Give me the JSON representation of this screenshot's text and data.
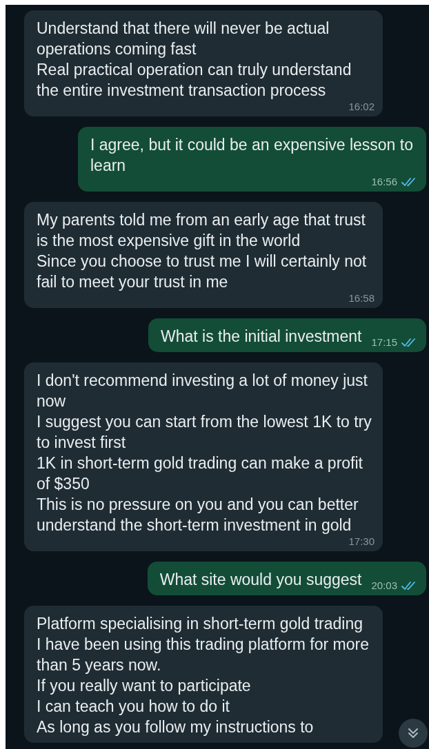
{
  "messages": [
    {
      "kind": "received",
      "paragraphs": [
        "Understand that there will never be actual operations coming fast",
        "Real practical operation can truly understand the entire investment transaction process"
      ],
      "time": "16:02"
    },
    {
      "kind": "sent",
      "paragraphs": [
        "I agree, but it could be an expensive lesson to learn"
      ],
      "time": "16:56",
      "read": true
    },
    {
      "kind": "received",
      "paragraphs": [
        "My parents told me from an early age that trust is the most expensive gift in the world",
        "Since you choose to trust me I will certainly not fail to meet your trust in me"
      ],
      "time": "16:58"
    },
    {
      "kind": "sent",
      "paragraphs": [
        "What is the initial investment"
      ],
      "time": "17:15",
      "read": true
    },
    {
      "kind": "received",
      "paragraphs": [
        "I don't recommend investing a lot of money just now",
        "I suggest you can start from the lowest 1K to try to invest first",
        "1K in short-term gold trading can make a profit of $350",
        "This is no pressure on you and you can better understand the short-term investment in gold"
      ],
      "time": "17:30"
    },
    {
      "kind": "sent",
      "paragraphs": [
        "What site would you suggest"
      ],
      "time": "20:03",
      "read": true
    },
    {
      "kind": "received",
      "paragraphs": [
        "Platform specialising in short-term gold trading",
        "I have been using this trading platform for more than 5 years now.",
        "If you really want to participate",
        "I can teach you how to do it",
        "As long as you follow my instructions to"
      ]
    }
  ]
}
